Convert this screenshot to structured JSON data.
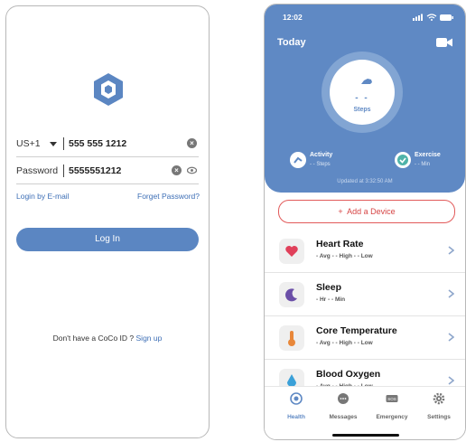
{
  "login": {
    "country_code": "US+1",
    "phone": "555 555 1212",
    "password_label": "Password",
    "password_value": "5555551212",
    "login_email_link": "Login by E-mail",
    "forgot_link": "Forget Password?",
    "login_button": "Log In",
    "no_account_text": "Don't have a CoCo ID ?",
    "sign_up_link": "Sign up"
  },
  "health": {
    "status_time": "12:02",
    "header_title": "Today",
    "steps_value": "- -",
    "steps_label": "Steps",
    "activity_label": "Activity",
    "activity_value": "- -  Steps",
    "exercise_label": "Exercise",
    "exercise_value": "- -  Min",
    "updated_text": "Updated at 3:32:50 AM",
    "add_device": "Add a Device",
    "cards": [
      {
        "name": "Heart Rate",
        "sub": "- Avg - - High - - Low",
        "icon": "heart-icon"
      },
      {
        "name": "Sleep",
        "sub": "- Hr - - Min",
        "icon": "moon-icon"
      },
      {
        "name": "Core Temperature",
        "sub": "- Avg - - High - - Low",
        "icon": "thermometer-icon"
      },
      {
        "name": "Blood Oxygen",
        "sub": "- Avg - - High - - Low",
        "icon": "droplet-icon"
      }
    ],
    "tabs": [
      "Health",
      "Messages",
      "Emergency",
      "Settings"
    ]
  },
  "colors": {
    "brand_blue": "#5f89c4",
    "link_blue": "#3e6fb6",
    "accent_red": "#d64545"
  }
}
